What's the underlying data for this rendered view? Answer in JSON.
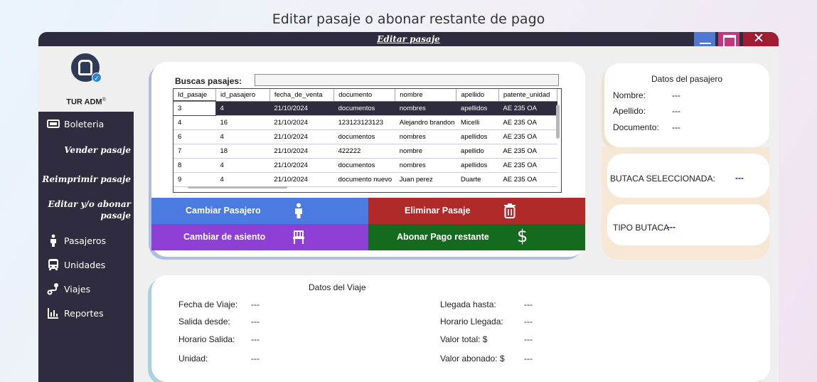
{
  "slide_title": "Editar pasaje o abonar restante de pago",
  "window": {
    "title": "Editar pasaje",
    "controls": {
      "minimize_color": "#4f77d4",
      "maximize_color": "#c7347e",
      "close_color": "#a01c33"
    }
  },
  "sidebar": {
    "logo_text": "TUR ADM",
    "logo_mark": "®",
    "items": [
      {
        "label": "Boleteria",
        "icon": "ticket-icon"
      },
      {
        "label": "Pasajeros",
        "icon": "person-icon"
      },
      {
        "label": "Unidades",
        "icon": "bus-icon"
      },
      {
        "label": "Viajes",
        "icon": "route-icon"
      },
      {
        "label": "Reportes",
        "icon": "chart-icon"
      }
    ],
    "subitems": {
      "vender": "Vender pasaje",
      "reimprimir": "Reimprimir pasaje",
      "editar_line1": "Editar y/o abonar",
      "editar_line2": "pasaje"
    }
  },
  "search": {
    "label": "Buscas pasajes:",
    "value": ""
  },
  "table": {
    "columns": [
      "Id_pasaje",
      "id_pasajero",
      "fecha_de_venta",
      "documento",
      "nombre",
      "apellido",
      "patente_unidad"
    ],
    "rows": [
      [
        "3",
        "4",
        "21/10/2024",
        "documentos",
        "nombres",
        "apellidos",
        "AE 235 OA"
      ],
      [
        "4",
        "16",
        "21/10/2024",
        "123123123123",
        "Alejandro brandon",
        "Micelli",
        "AE 235 OA"
      ],
      [
        "6",
        "4",
        "21/10/2024",
        "documentos",
        "nombres",
        "apellidos",
        "AE 235 OA"
      ],
      [
        "7",
        "18",
        "21/10/2024",
        "422222",
        "nombre",
        "apellido",
        "AE 235 OA"
      ],
      [
        "8",
        "4",
        "21/10/2024",
        "documentos",
        "nombres",
        "apellidos",
        "AE 235 OA"
      ],
      [
        "9",
        "4",
        "21/10/2024",
        "documento nuevo",
        "Juan perez",
        "Duarte",
        "AE 235 OA"
      ]
    ],
    "selected_row": 0
  },
  "actions": {
    "cambiar_pasajero": {
      "label": "Cambiar Pasajero",
      "color": "#4b7be0"
    },
    "eliminar_pasaje": {
      "label": "Eliminar Pasaje",
      "color": "#b02a2a"
    },
    "cambiar_asiento": {
      "label": "Cambiar de asiento",
      "color": "#8d3fd6"
    },
    "abonar_pago": {
      "label": "Abonar Pago restante",
      "color": "#156b1d"
    }
  },
  "pasajero": {
    "title": "Datos del pasajero",
    "nombre_label": "Nombre:",
    "nombre_value": "---",
    "apellido_label": "Apellido:",
    "apellido_value": "---",
    "documento_label": "Documento:",
    "documento_value": "---"
  },
  "butaca": {
    "label": "BUTACA SELECCIONADA:",
    "value": "---"
  },
  "tipo_butaca": {
    "label": "TIPO BUTACA",
    "value": "---"
  },
  "viaje": {
    "title": "Datos del Viaje",
    "fecha_label": "Fecha de Viaje:",
    "fecha_value": "---",
    "salida_label": "Salida desde:",
    "salida_value": "---",
    "horario_salida_label": "Horario Salida:",
    "horario_salida_value": "---",
    "unidad_label": "Unidad:",
    "unidad_value": "---",
    "llegada_label": "Llegada hasta:",
    "llegada_value": "---",
    "horario_llegada_label": "Horario Llegada:",
    "horario_llegada_value": "---",
    "valor_total_label": "Valor total: $",
    "valor_total_value": "---",
    "valor_abonado_label": "Valor abonado: $",
    "valor_abonado_value": "---"
  }
}
